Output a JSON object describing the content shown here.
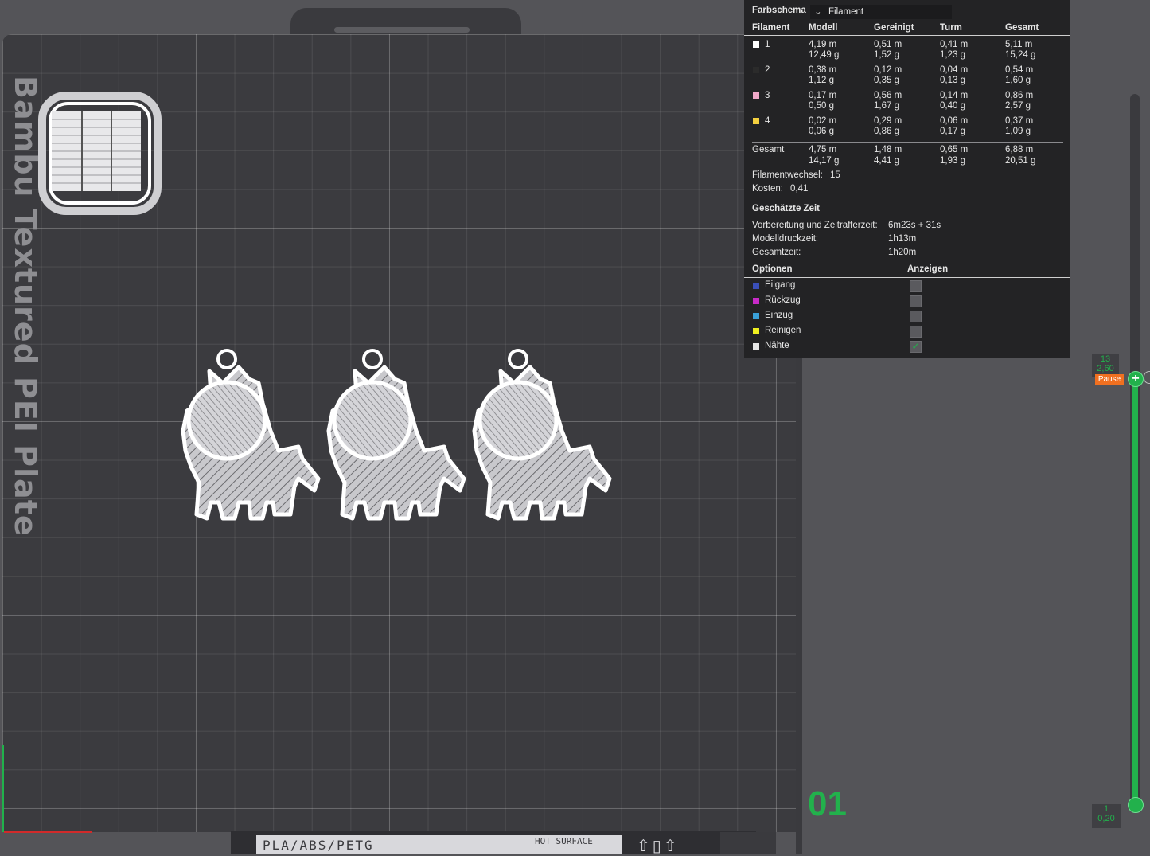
{
  "plate": {
    "label": "Bambu Textured PEI Plate",
    "bottom_text": "PLA/ABS/PETG",
    "hot_text": "HOT SURFACE",
    "bottom_icons": "⇧▯⇧",
    "number": "01"
  },
  "stats": {
    "scheme_label": "Farbschema",
    "scheme_value": "Filament",
    "headers": [
      "Filament",
      "Modell",
      "Gereinigt",
      "Turm",
      "Gesamt"
    ],
    "rows": [
      {
        "id": "1",
        "color": "#ffffff",
        "model": [
          "4,19 m",
          "12,49 g"
        ],
        "purged": [
          "0,51 m",
          "1,52 g"
        ],
        "tower": [
          "0,41 m",
          "1,23 g"
        ],
        "total": [
          "5,11 m",
          "15,24 g"
        ]
      },
      {
        "id": "2",
        "color": "#2b2b2b",
        "model": [
          "0,38 m",
          "1,12 g"
        ],
        "purged": [
          "0,12 m",
          "0,35 g"
        ],
        "tower": [
          "0,04 m",
          "0,13 g"
        ],
        "total": [
          "0,54 m",
          "1,60 g"
        ]
      },
      {
        "id": "3",
        "color": "#f0a8c8",
        "model": [
          "0,17 m",
          "0,50 g"
        ],
        "purged": [
          "0,56 m",
          "1,67 g"
        ],
        "tower": [
          "0,14 m",
          "0,40 g"
        ],
        "total": [
          "0,86 m",
          "2,57 g"
        ]
      },
      {
        "id": "4",
        "color": "#f4d03f",
        "model": [
          "0,02 m",
          "0,06 g"
        ],
        "purged": [
          "0,29 m",
          "0,86 g"
        ],
        "tower": [
          "0,06 m",
          "0,17 g"
        ],
        "total": [
          "0,37 m",
          "1,09 g"
        ]
      }
    ],
    "sum": {
      "label": "Gesamt",
      "model": [
        "4,75 m",
        "14,17 g"
      ],
      "purged": [
        "1,48 m",
        "4,41 g"
      ],
      "tower": [
        "0,65 m",
        "1,93 g"
      ],
      "total": [
        "6,88 m",
        "20,51 g"
      ]
    },
    "changes_label": "Filamentwechsel:",
    "changes_value": "15",
    "cost_label": "Kosten:",
    "cost_value": "0,41",
    "time_header": "Geschätzte Zeit",
    "prep_label": "Vorbereitung und Zeitrafferzeit:",
    "prep_value": "6m23s + 31s",
    "model_time_label": "Modelldruckzeit:",
    "model_time_value": "1h13m",
    "total_time_label": "Gesamtzeit:",
    "total_time_value": "1h20m",
    "options_header": "Optionen",
    "show_header": "Anzeigen",
    "options": [
      {
        "label": "Eilgang",
        "color": "#3a4fb8",
        "checked": false
      },
      {
        "label": "Rückzug",
        "color": "#c82ac8",
        "checked": false
      },
      {
        "label": "Einzug",
        "color": "#3aa0d8",
        "checked": false
      },
      {
        "label": "Reinigen",
        "color": "#f0f020",
        "checked": false
      },
      {
        "label": "Nähte",
        "color": "#e6e6e6",
        "checked": true
      }
    ]
  },
  "slider": {
    "top_layer": "13",
    "top_height": "2,60",
    "pause_label": "Pause",
    "bottom_layer": "1",
    "bottom_height": "0,20"
  }
}
